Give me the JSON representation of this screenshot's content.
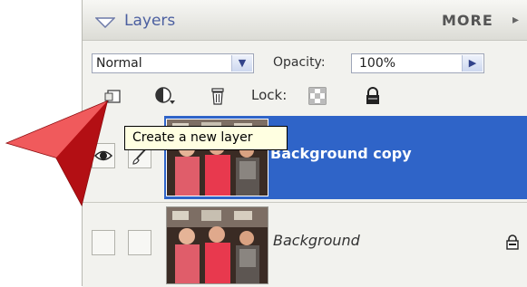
{
  "panel": {
    "title": "Layers",
    "more_label": "MORE",
    "more_arrow": "▸"
  },
  "blend_mode": {
    "value": "Normal"
  },
  "opacity": {
    "label": "Opacity:",
    "value": "100%"
  },
  "toolbar": {
    "lock_label": "Lock:",
    "icons": [
      "new-layer-icon",
      "adjustment-layer-icon",
      "trash-icon",
      "lock-transparency-icon",
      "lock-all-icon"
    ]
  },
  "layers": [
    {
      "name": "Background copy",
      "selected": true,
      "visible": true,
      "locked": false
    },
    {
      "name": "Background",
      "selected": false,
      "visible": false,
      "locked": true
    }
  ],
  "tooltip": {
    "text": "Create a new layer"
  },
  "colors": {
    "selection": "#2f64c8",
    "pointer": "#e0161b",
    "tooltip_bg": "#ffffe1",
    "title_text": "#4b5fa0"
  }
}
